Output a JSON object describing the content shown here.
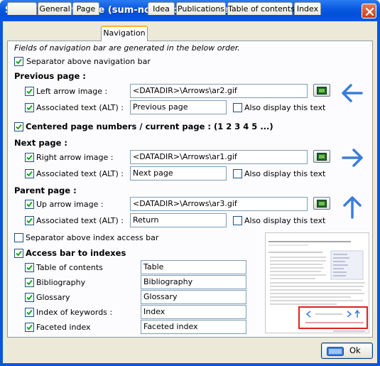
{
  "window": {
    "title": "Structure template (sum-november-2007.emd)*"
  },
  "tabs": [
    {
      "label": ""
    },
    {
      "label": "General"
    },
    {
      "label": "Page"
    },
    {
      "label": "Navigation"
    },
    {
      "label": "Idea"
    },
    {
      "label": "Publications"
    },
    {
      "label": "Table of contents"
    },
    {
      "label": "Index"
    }
  ],
  "panel": {
    "note": "Fields of navigation bar are generated in the below order.",
    "separator_nav": {
      "label": "Separator above navigation bar",
      "checked": true
    },
    "previous": {
      "heading": "Previous page :",
      "arrow_label": "Left arrow image :",
      "arrow_value": "<DATADIR>\\Arrows\\ar2.gif",
      "alt_label": "Associated text (ALT) :",
      "alt_value": "Previous page",
      "also_display": "Also display this text"
    },
    "centered": {
      "label": "Centered page numbers / current page   : (1 2 3 4 5 ...)",
      "checked": true
    },
    "next": {
      "heading": "Next page :",
      "arrow_label": "Right arrow image :",
      "arrow_value": "<DATADIR>\\Arrows\\ar1.gif",
      "alt_label": "Associated text (ALT) :",
      "alt_value": "Next page",
      "also_display": "Also display this text"
    },
    "parent": {
      "heading": "Parent page :",
      "arrow_label": "Up arrow image :",
      "arrow_value": "<DATADIR>\\Arrows\\ar3.gif",
      "alt_label": "Associated text (ALT) :",
      "alt_value": "Return",
      "also_display": "Also display this text"
    },
    "separator_index": {
      "label": "Separator above index access bar",
      "checked": false
    },
    "access_bar": {
      "label": "Access bar to indexes",
      "checked": true
    },
    "indexes": [
      {
        "label": "Table of contents",
        "value": "Table"
      },
      {
        "label": "Bibliography",
        "value": "Bibliography"
      },
      {
        "label": "Glossary",
        "value": "Glossary"
      },
      {
        "label": "Index of keywords :",
        "value": "Index"
      },
      {
        "label": "Faceted index",
        "value": "Faceted index"
      }
    ]
  },
  "ok_button": {
    "label": "Ok"
  },
  "colors": {
    "arrow": "#3b7dd8",
    "title_bar": "#0a56d8",
    "preview_highlight": "#e02020"
  }
}
